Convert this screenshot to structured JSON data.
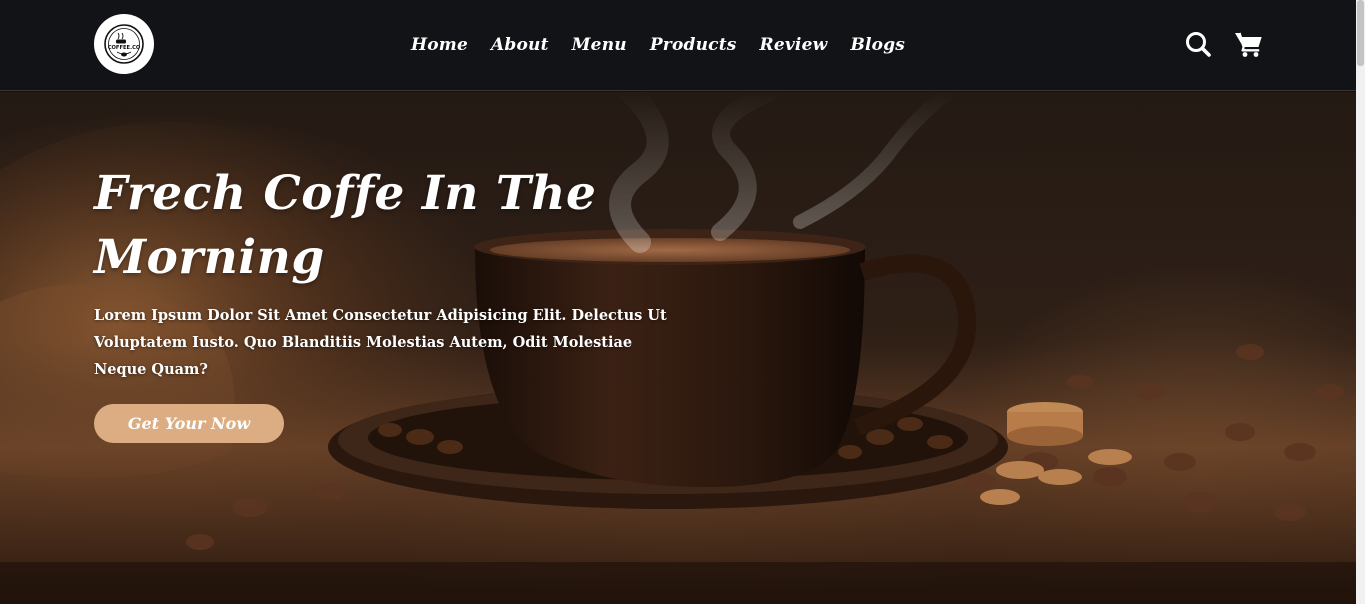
{
  "header": {
    "logo_text": "COFFEE.CO",
    "nav": [
      {
        "label": "Home"
      },
      {
        "label": "About"
      },
      {
        "label": "Menu"
      },
      {
        "label": "Products"
      },
      {
        "label": "Review"
      },
      {
        "label": "Blogs"
      }
    ],
    "icons": [
      "search-icon",
      "cart-icon"
    ]
  },
  "hero": {
    "title_line1": "Frech Coffe In The",
    "title_line2": "Morning",
    "text": "Lorem Ipsum Dolor Sit Amet Consectetur Adipisicing Elit. Delectus Ut Voluptatem Iusto. Quo Blanditiis Molestias Autem, Odit Molestiae Neque Quam?",
    "cta_label": "Get Your Now"
  },
  "colors": {
    "header_bg": "#121317",
    "accent": "#dcad82",
    "text": "#ffffff"
  }
}
